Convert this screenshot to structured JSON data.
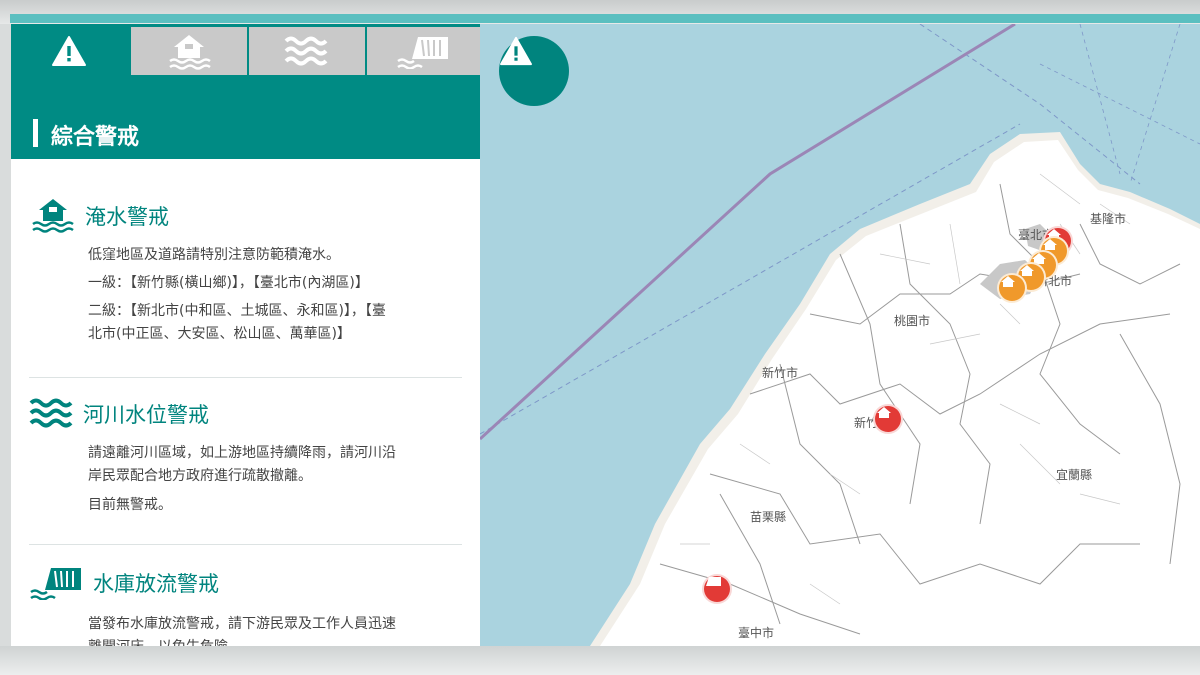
{
  "tabs": [
    {
      "name": "tab-overall-alert",
      "icon": "alert-icon"
    },
    {
      "name": "tab-flood",
      "icon": "flood-house-icon"
    },
    {
      "name": "tab-river",
      "icon": "water-waves-icon"
    },
    {
      "name": "tab-reservoir",
      "icon": "dam-icon"
    }
  ],
  "panel": {
    "title": "綜合警戒"
  },
  "sections": {
    "flood": {
      "title": "淹水警戒",
      "desc": "低窪地區及道路請特別注意防範積淹水。",
      "level1": "一級：【新竹縣(橫山鄉)】，【臺北市(內湖區)】",
      "level2_a": "二級：【新北市(中和區、土城區、永和區)】，【臺",
      "level2_b": "北市(中正區、大安區、松山區、萬華區)】"
    },
    "river": {
      "title": "河川水位警戒",
      "desc_a": "請遠離河川區域，如上游地區持續降雨，請河川沿",
      "desc_b": "岸民眾配合地方政府進行疏散撤離。",
      "status": "目前無警戒。"
    },
    "reservoir": {
      "title": "水庫放流警戒",
      "desc_a": "當發布水庫放流警戒，請下游民眾及工作人員迅速",
      "desc_b": "離開河床，以免生危險。"
    }
  },
  "map": {
    "places": {
      "keelung": "基隆市",
      "taipei": "臺北市",
      "new_taipei": "新北市",
      "taoyuan": "桃園市",
      "hsinchu_city": "新竹市",
      "hsinchu_county": "新竹縣",
      "yilan": "宜蘭縣",
      "miaoli": "苗栗縣",
      "taichung": "臺中市"
    }
  },
  "colors": {
    "teal": "#008b84",
    "alert_red": "#e23a36",
    "alert_orange": "#f0992b",
    "sea": "#aad3df"
  }
}
